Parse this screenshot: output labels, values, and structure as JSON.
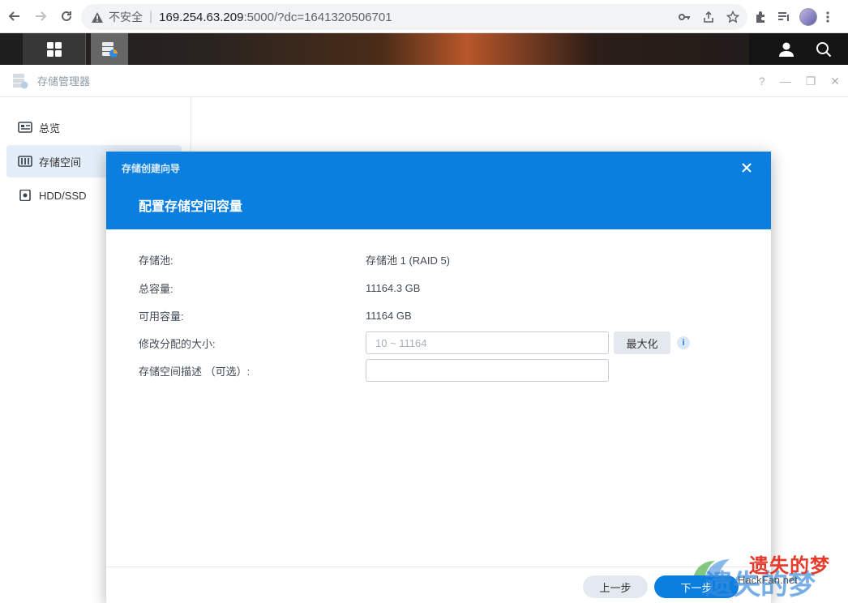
{
  "browser": {
    "insecure_label": "不安全",
    "url_host": "169.254.63.209",
    "url_rest": ":5000/?dc=1641320506701"
  },
  "window": {
    "title": "存储管理器",
    "controls": [
      "?",
      "—",
      "❐",
      "✕"
    ]
  },
  "sidebar": {
    "items": [
      {
        "label": "总览",
        "icon": "overview-icon"
      },
      {
        "label": "存储空间",
        "icon": "storage-pool-icon",
        "active": true
      },
      {
        "label": "HDD/SSD",
        "icon": "disk-icon"
      }
    ]
  },
  "dialog": {
    "wizard_title": "存储创建向导",
    "step_title": "配置存储空间容量",
    "fields": [
      {
        "label": "存储池:",
        "value": "存储池 1 (RAID 5)"
      },
      {
        "label": "总容量:",
        "value": "11164.3 GB"
      },
      {
        "label": "可用容量:",
        "value": "11164 GB"
      }
    ],
    "size_label": "修改分配的大小:",
    "size_placeholder": "10 ~ 11164",
    "max_button": "最大化",
    "info_icon": "i",
    "desc_label": "存储空间描述 （可选）:",
    "desc_value": "",
    "prev_button": "上一步",
    "next_button": "下一步"
  },
  "watermark": {
    "main": "遗失的梦",
    "site": "HackFan.net",
    "ghost": "遗失的梦"
  },
  "colors": {
    "accent": "#0a7fe0",
    "sidebar_active": "#e4eef8"
  }
}
